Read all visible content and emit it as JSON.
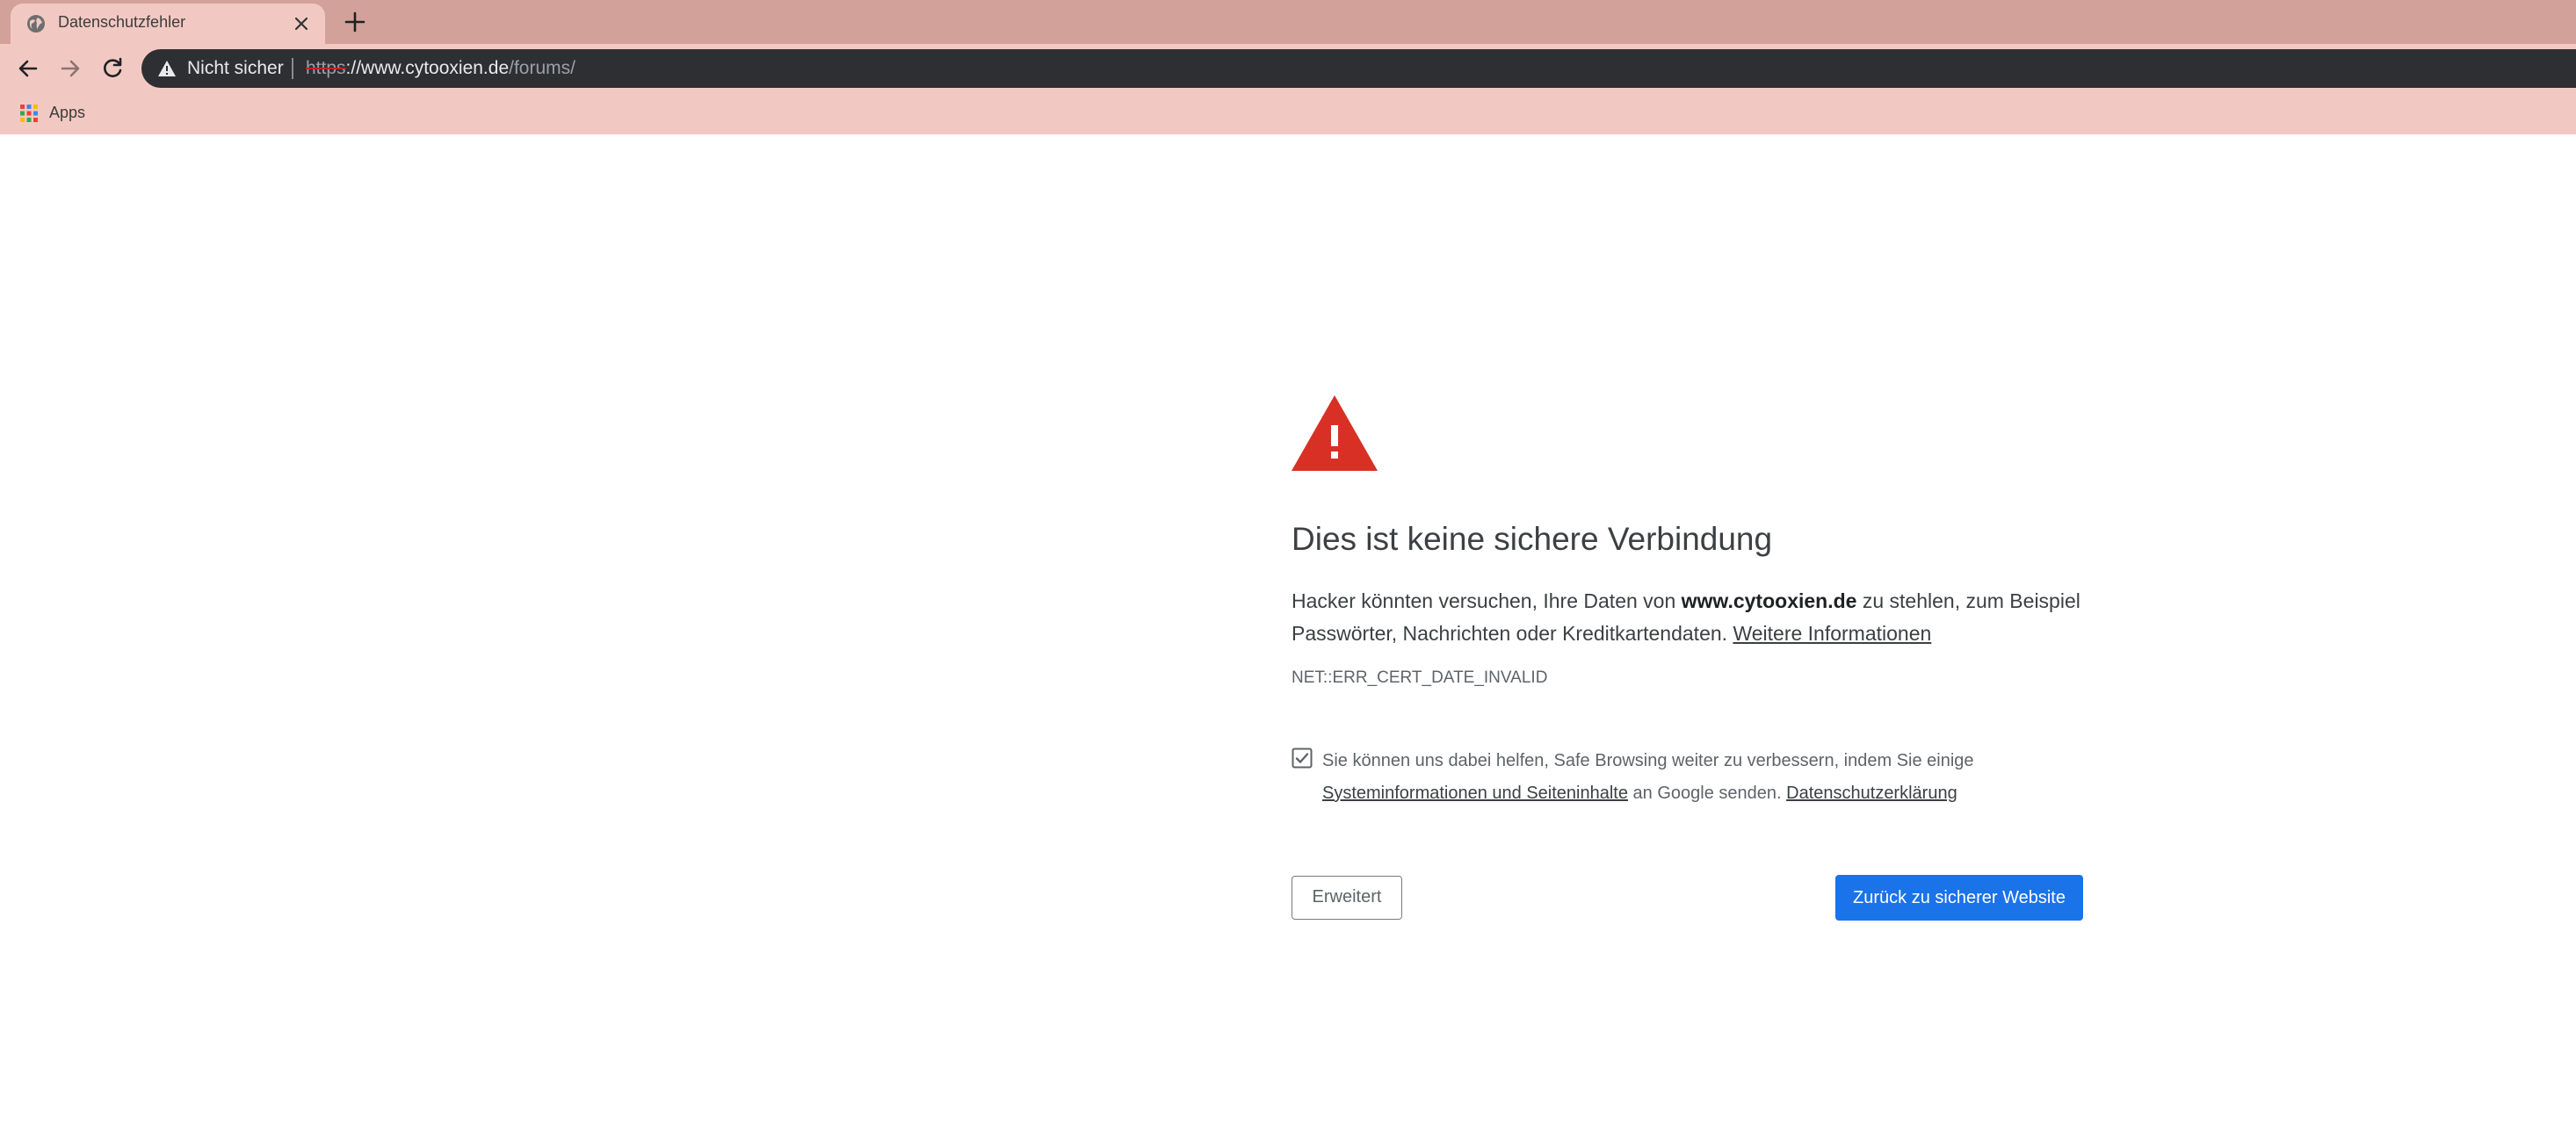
{
  "browser": {
    "tab": {
      "title": "Datenschutzfehler"
    },
    "omnibox": {
      "security_label": "Nicht sicher",
      "url_scheme": "https",
      "url_host": "://www.cytooxien.de",
      "url_path": "/forums/"
    },
    "bookmarks": {
      "apps_label": "Apps"
    },
    "colors": {
      "tabstrip": "#d2a19a",
      "toolbar": "#f2c9c2",
      "omnibox": "#2e2f33"
    }
  },
  "page": {
    "heading": "Dies ist keine sichere Verbindung",
    "explanation_pre": "Hacker könnten versuchen, Ihre Daten von ",
    "explanation_host": "www.cytooxien.de",
    "explanation_post": " zu stehlen, zum Beispiel Passwörter, Nachrichten oder Kreditkartendaten. ",
    "learn_more_link": "Weitere Informationen",
    "error_code": "NET::ERR_CERT_DATE_INVALID",
    "optin_checked": true,
    "optin_text_pre": "Sie können uns dabei helfen, Safe Browsing weiter zu verbessern, indem Sie einige ",
    "optin_link": "Systeminformationen und Seiteninhalte",
    "optin_text_mid": " an Google senden. ",
    "privacy_link": "Datenschutzerklärung",
    "advanced_button": "Erweitert",
    "back_button": "Zurück zu sicherer Website",
    "colors": {
      "warning_icon": "#d93025",
      "primary_button": "#1a73e8"
    }
  },
  "icons": [
    "globe-icon",
    "close-icon",
    "plus-icon",
    "back-arrow-icon",
    "forward-arrow-icon",
    "reload-icon",
    "warning-triangle-icon",
    "apps-grid-icon",
    "checkbox-checked-icon"
  ]
}
